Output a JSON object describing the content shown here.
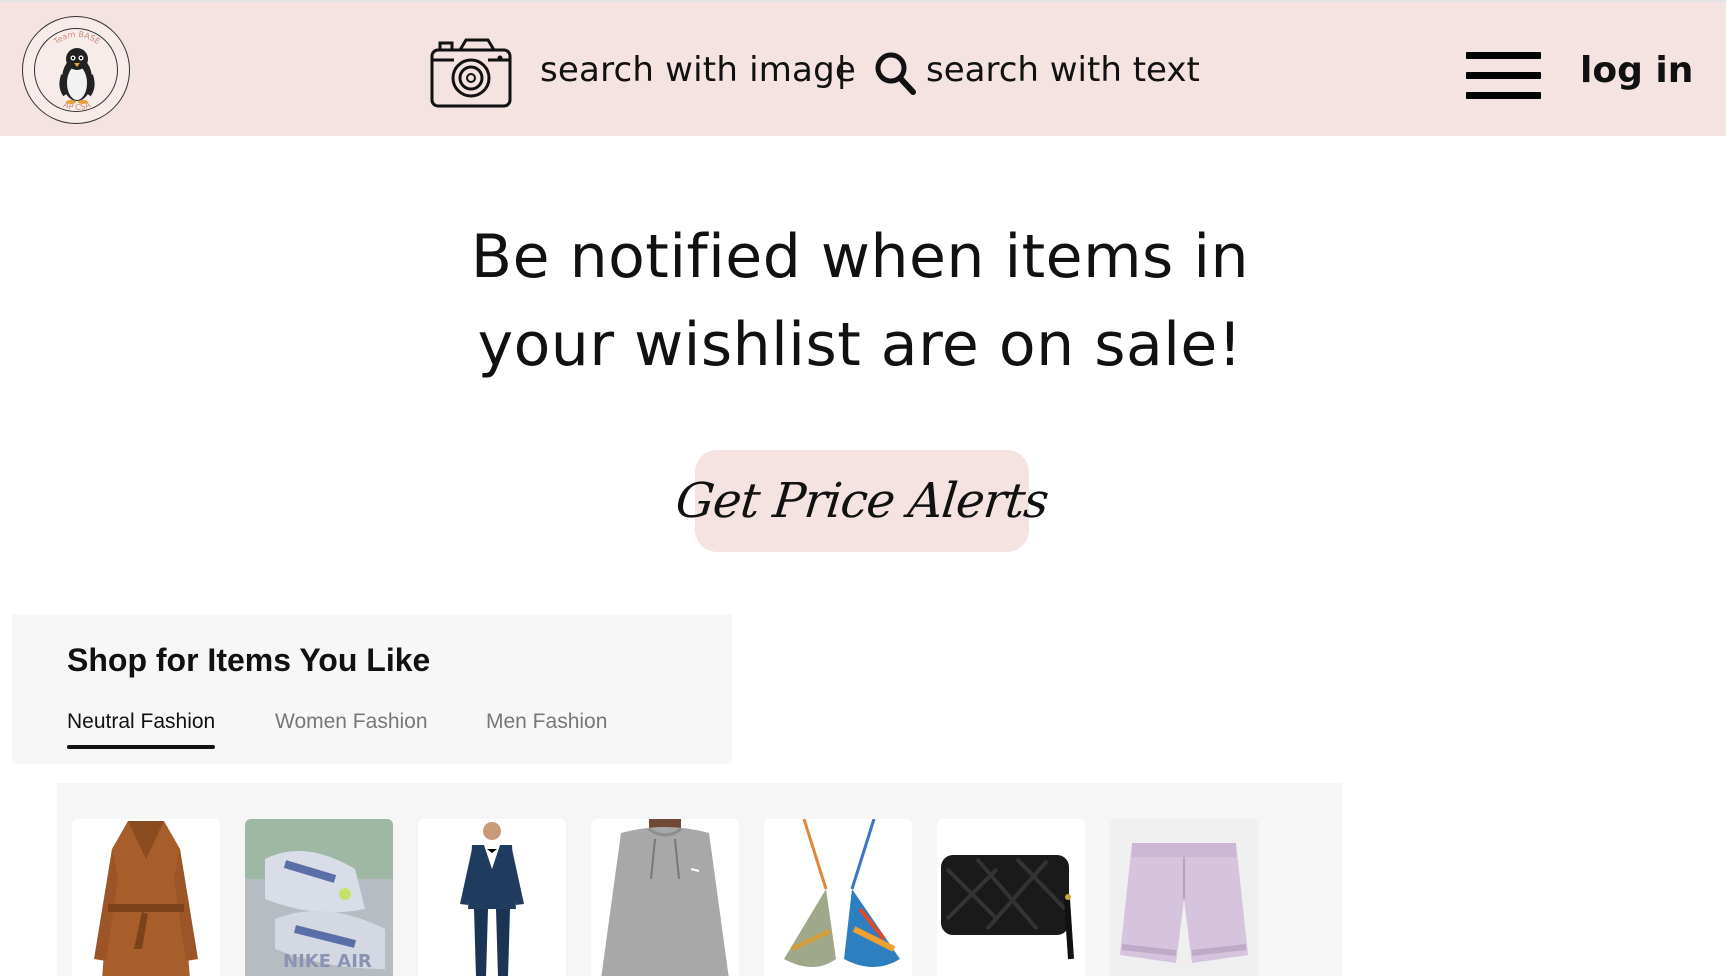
{
  "header": {
    "logo_alt": "Team BASE AP CSA penguin logo",
    "logo_text_top": "Team BASE",
    "logo_text_bottom": "AP CSA",
    "search_image_label": "search with image",
    "divider": "|",
    "search_text_label": "search with text",
    "menu_icon": "hamburger-menu-icon",
    "login_label": "log in"
  },
  "hero": {
    "line1": "Be notified when items in",
    "line2": "your wishlist are on sale!",
    "cta_label": "Get Price Alerts"
  },
  "shop": {
    "title": "Shop for Items You Like",
    "tabs": [
      {
        "label": "Neutral Fashion",
        "active": true
      },
      {
        "label": "Women Fashion",
        "active": false
      },
      {
        "label": "Men Fashion",
        "active": false
      }
    ]
  },
  "products": [
    {
      "name": "brown wrap coat"
    },
    {
      "name": "nike air sneakers"
    },
    {
      "name": "navy tuxedo"
    },
    {
      "name": "grey sweatshirt"
    },
    {
      "name": "printed bikini top"
    },
    {
      "name": "black woven bag"
    },
    {
      "name": "lilac shorts"
    }
  ],
  "colors": {
    "header_bg": "#f4e3e1",
    "cta_bg": "#f4e3e1",
    "panel_bg": "#f7f7f7"
  }
}
